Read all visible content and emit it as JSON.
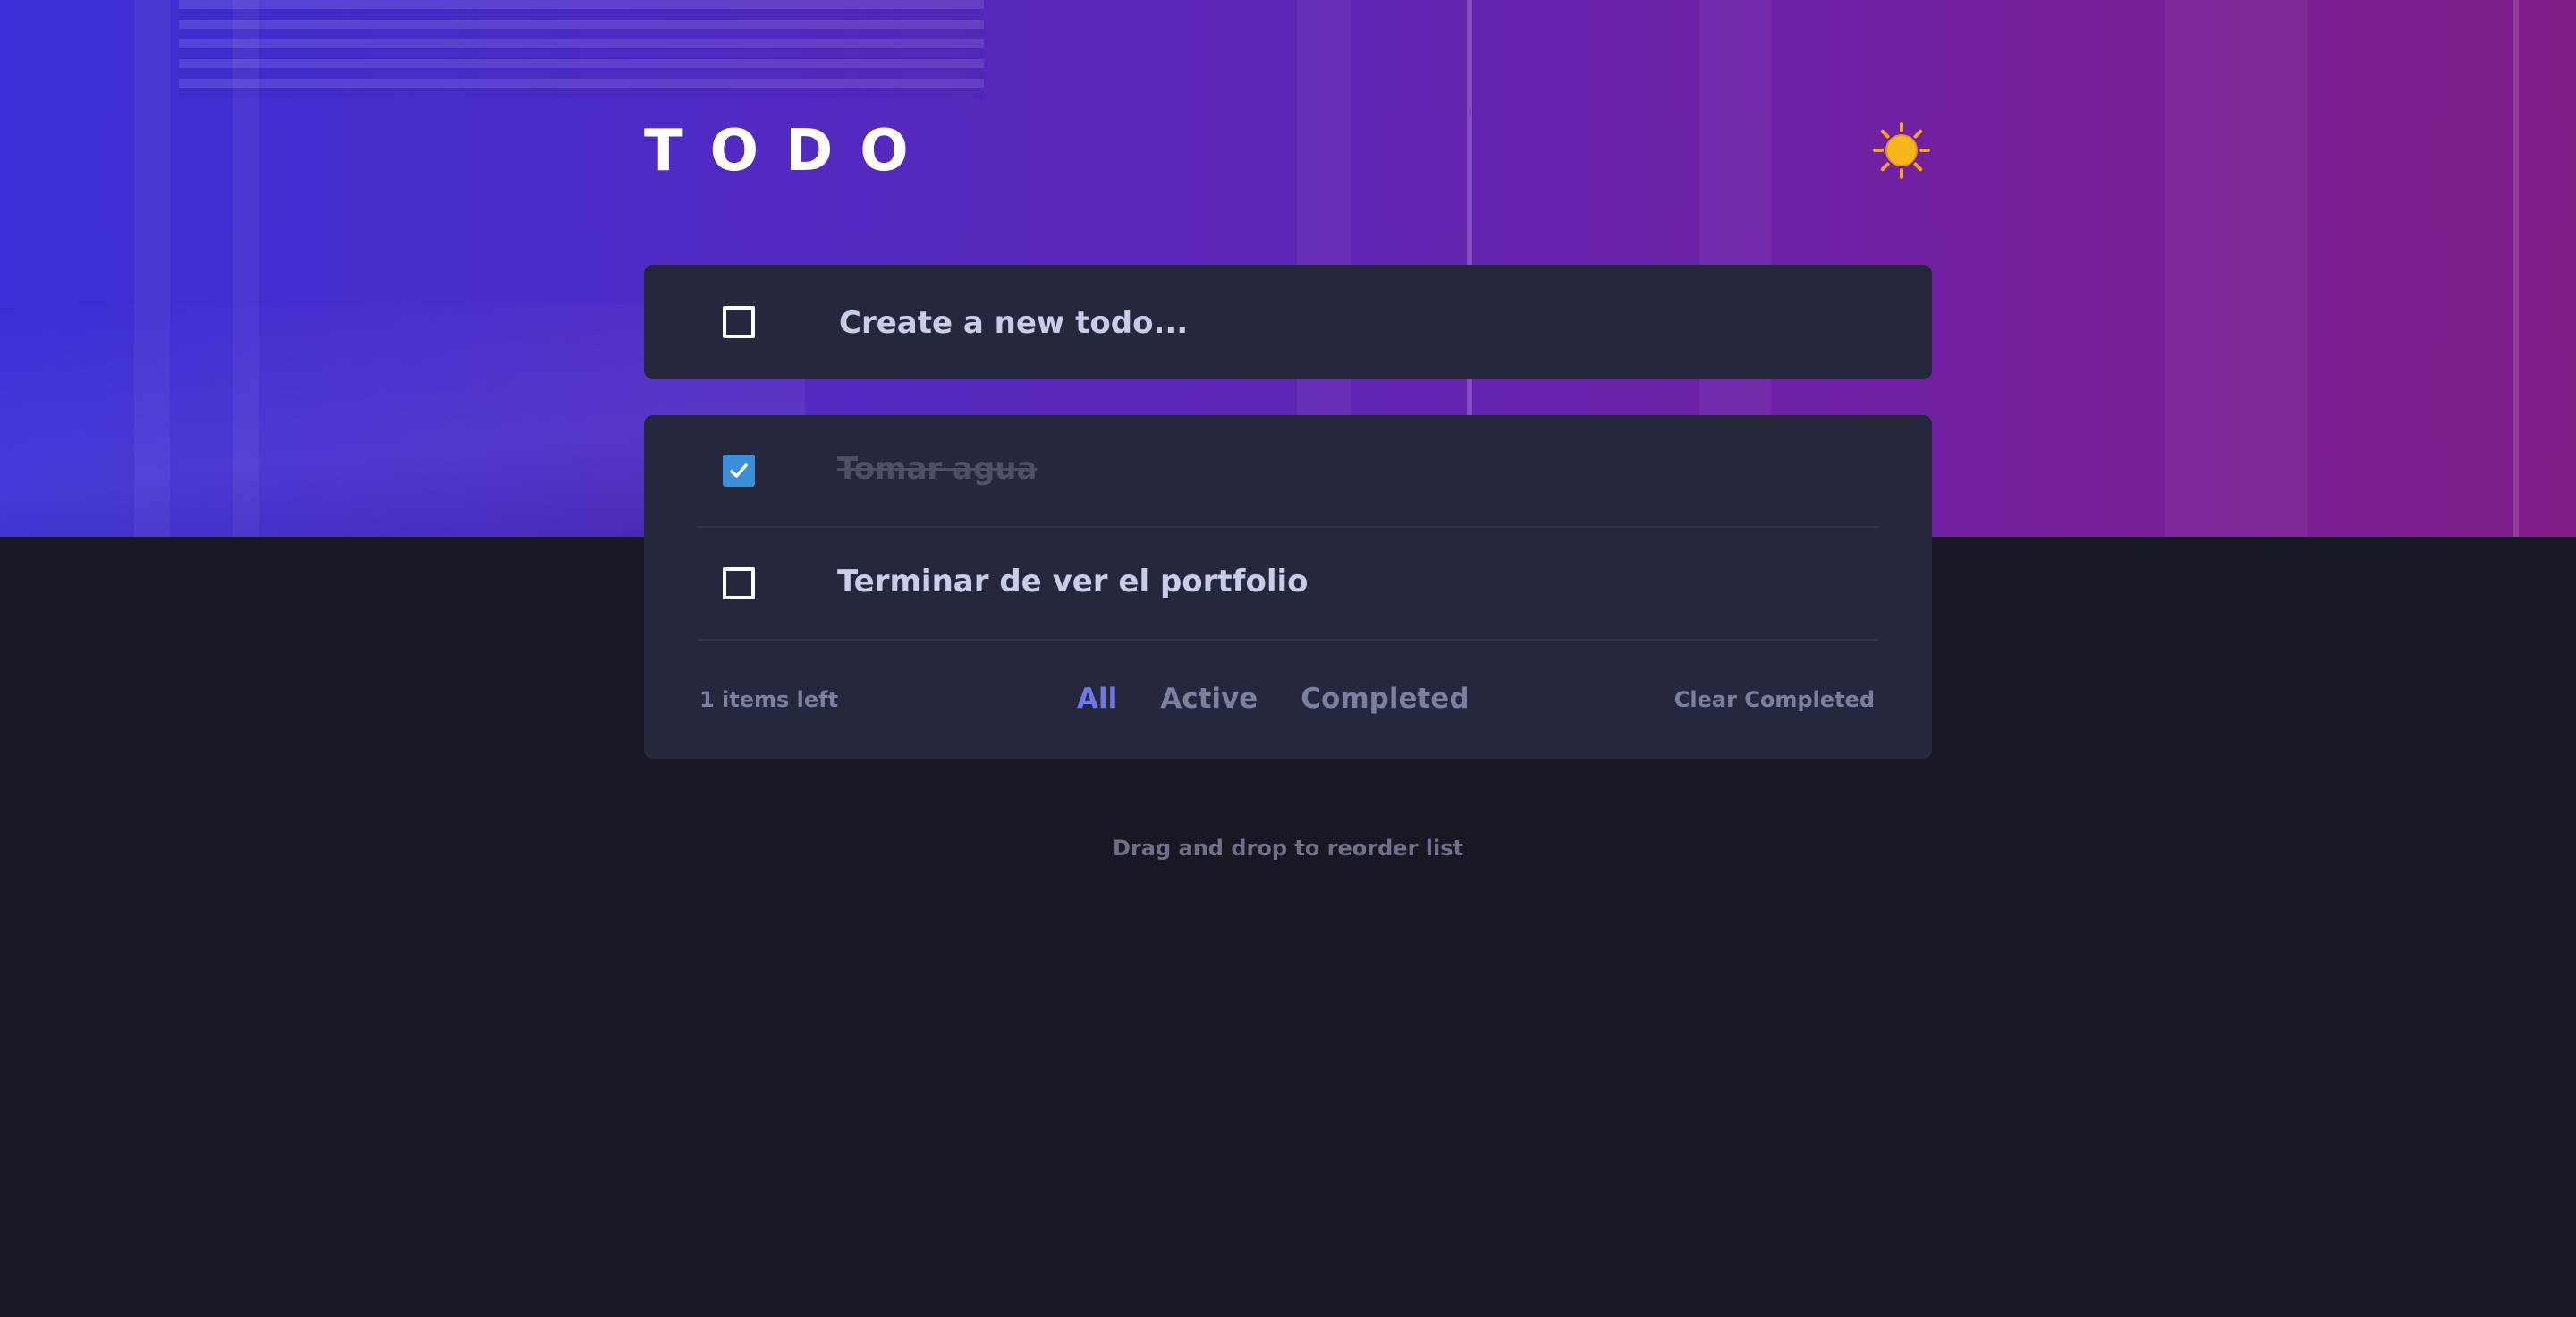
{
  "header": {
    "title": "TODO",
    "theme_toggle_icon": "sun-icon"
  },
  "new_todo": {
    "placeholder": "Create a new todo..."
  },
  "todos": [
    {
      "text": "Tomar agua",
      "completed": true
    },
    {
      "text": "Terminar de ver el portfolio",
      "completed": false
    }
  ],
  "footer": {
    "items_left": "1 items left",
    "filters": [
      "All",
      "Active",
      "Completed"
    ],
    "active_filter": "All",
    "clear_label": "Clear Completed"
  },
  "hint": "Drag and drop to reorder list",
  "colors": {
    "accent": "#6f78e9",
    "check": "#3b8fd8",
    "card": "#25273c",
    "background": "#181824"
  }
}
